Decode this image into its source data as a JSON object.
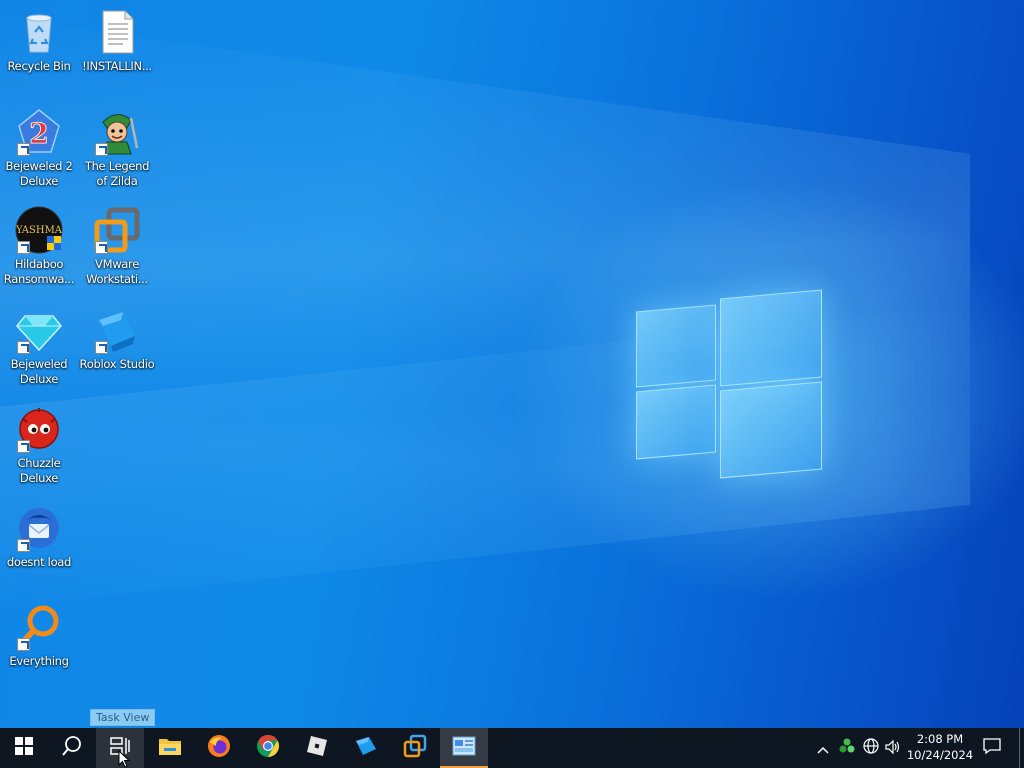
{
  "desktop_icons": [
    {
      "name": "recycle-bin-icon",
      "label": "Recycle Bin"
    },
    {
      "name": "text-file-icon",
      "label": "!INSTALLIN..."
    },
    {
      "name": "bejeweled-2-icon",
      "label": "Bejeweled 2 Deluxe"
    },
    {
      "name": "legend-of-zilda-icon",
      "label": "The Legend of Zilda"
    },
    {
      "name": "hildaboo-ransomware-icon",
      "label": "Hildaboo Ransomwa...",
      "badge_text": "YASHMA"
    },
    {
      "name": "vmware-workstation-icon",
      "label": "VMware Workstati..."
    },
    {
      "name": "bejeweled-deluxe-icon",
      "label": "Bejeweled Deluxe"
    },
    {
      "name": "roblox-studio-icon",
      "label": "Roblox Studio"
    },
    {
      "name": "chuzzle-deluxe-icon",
      "label": "Chuzzle Deluxe"
    },
    {
      "name": "thunderbird-icon",
      "label": "doesnt load"
    },
    {
      "name": "everything-search-icon",
      "label": "Everything"
    }
  ],
  "tooltip": {
    "text": "Task View"
  },
  "taskbar": {
    "buttons": [
      {
        "name": "start-button",
        "icon": "windows-logo-icon"
      },
      {
        "name": "search-button",
        "icon": "search-icon"
      },
      {
        "name": "task-view-button",
        "icon": "task-view-icon"
      },
      {
        "name": "file-explorer-button",
        "icon": "folder-icon"
      },
      {
        "name": "firefox-button",
        "icon": "firefox-icon"
      },
      {
        "name": "chrome-button",
        "icon": "chrome-icon"
      },
      {
        "name": "roblox-button",
        "icon": "roblox-icon"
      },
      {
        "name": "roblox-studio-button",
        "icon": "roblox-studio-icon"
      },
      {
        "name": "vmware-button",
        "icon": "vmware-icon"
      },
      {
        "name": "control-panel-button",
        "icon": "control-panel-icon"
      }
    ],
    "tray": {
      "time": "2:08 PM",
      "date": "10/24/2024"
    }
  },
  "colors": {
    "taskbar_bg": "#0e1621",
    "active_indicator": "#f5a142",
    "wallpaper_accent": "#0a73dc"
  }
}
